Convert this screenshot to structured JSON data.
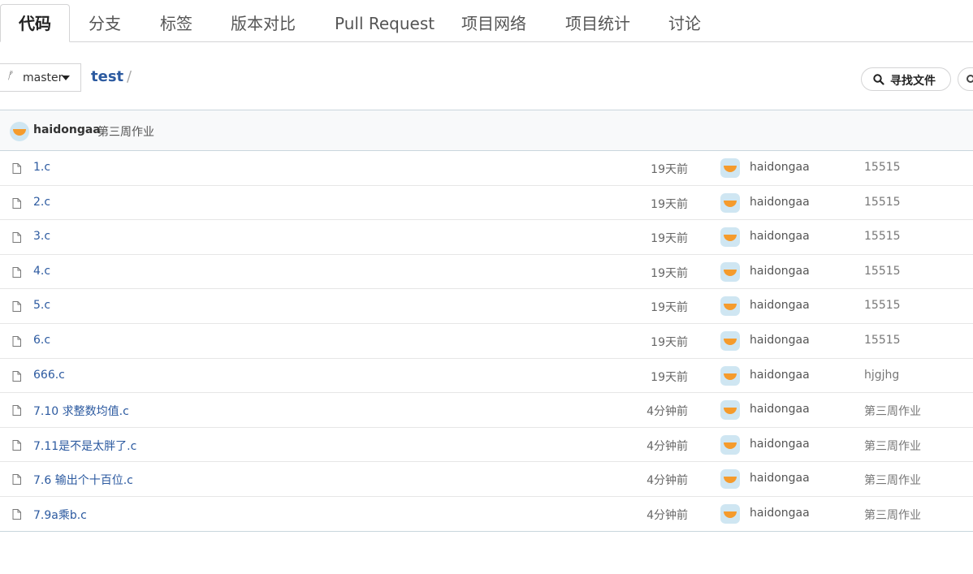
{
  "tabs": [
    {
      "label": "代码",
      "active": true
    },
    {
      "label": "分支"
    },
    {
      "label": "标签"
    },
    {
      "label": "版本对比"
    },
    {
      "label": "Pull Request"
    },
    {
      "label": "项目网络"
    },
    {
      "label": "项目统计"
    },
    {
      "label": "讨论"
    }
  ],
  "branch": {
    "icon": "branch-icon",
    "name": "master"
  },
  "repo": {
    "name": "test",
    "separator": "/"
  },
  "find_file_label": "寻找文件",
  "latest_commit": {
    "author": "haidongaa",
    "message": "第三周作业"
  },
  "files": [
    {
      "name": "1.c",
      "time": "19天前",
      "author": "haidongaa",
      "commit": "15515"
    },
    {
      "name": "2.c",
      "time": "19天前",
      "author": "haidongaa",
      "commit": "15515"
    },
    {
      "name": "3.c",
      "time": "19天前",
      "author": "haidongaa",
      "commit": "15515"
    },
    {
      "name": "4.c",
      "time": "19天前",
      "author": "haidongaa",
      "commit": "15515"
    },
    {
      "name": "5.c",
      "time": "19天前",
      "author": "haidongaa",
      "commit": "15515"
    },
    {
      "name": "6.c",
      "time": "19天前",
      "author": "haidongaa",
      "commit": "15515"
    },
    {
      "name": "666.c",
      "time": "19天前",
      "author": "haidongaa",
      "commit": "hjgjhg"
    },
    {
      "name": "7.10 求整数均值.c",
      "time": "4分钟前",
      "author": "haidongaa",
      "commit": "第三周作业"
    },
    {
      "name": "7.11是不是太胖了.c",
      "time": "4分钟前",
      "author": "haidongaa",
      "commit": "第三周作业"
    },
    {
      "name": "7.6 输出个十百位.c",
      "time": "4分钟前",
      "author": "haidongaa",
      "commit": "第三周作业"
    },
    {
      "name": "7.9a乘b.c",
      "time": "4分钟前",
      "author": "haidongaa",
      "commit": "第三周作业"
    }
  ],
  "colors": {
    "link": "#2c5aa0",
    "avatar_bg": "#cfe6f2",
    "avatar_fg": "#f59b2c"
  }
}
